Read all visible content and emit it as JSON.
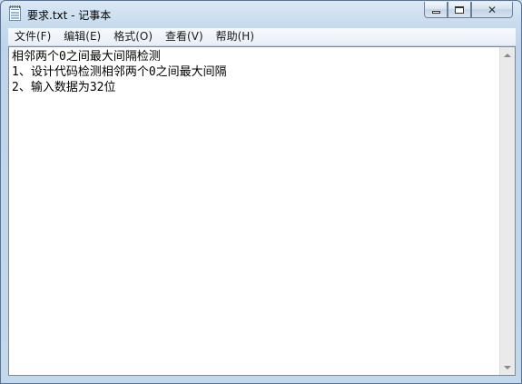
{
  "window": {
    "title": "要求.txt - 记事本"
  },
  "icons": {
    "app": "notepad-icon",
    "minimize": "minimize-icon",
    "maximize": "maximize-icon",
    "close": "close-icon",
    "scroll_up": "scroll-up-arrow-icon",
    "scroll_down": "scroll-down-arrow-icon"
  },
  "menu": {
    "items": [
      {
        "label": "文件(F)"
      },
      {
        "label": "编辑(E)"
      },
      {
        "label": "格式(O)"
      },
      {
        "label": "查看(V)"
      },
      {
        "label": "帮助(H)"
      }
    ]
  },
  "editor": {
    "lines": [
      "相邻两个0之间最大间隔检测",
      "1、设计代码检测相邻两个0之间最大间隔",
      "2、输入数据为32位"
    ]
  },
  "colors": {
    "window_frame": "#c7d9ea",
    "editor_background": "#ffffff",
    "text": "#000000"
  }
}
